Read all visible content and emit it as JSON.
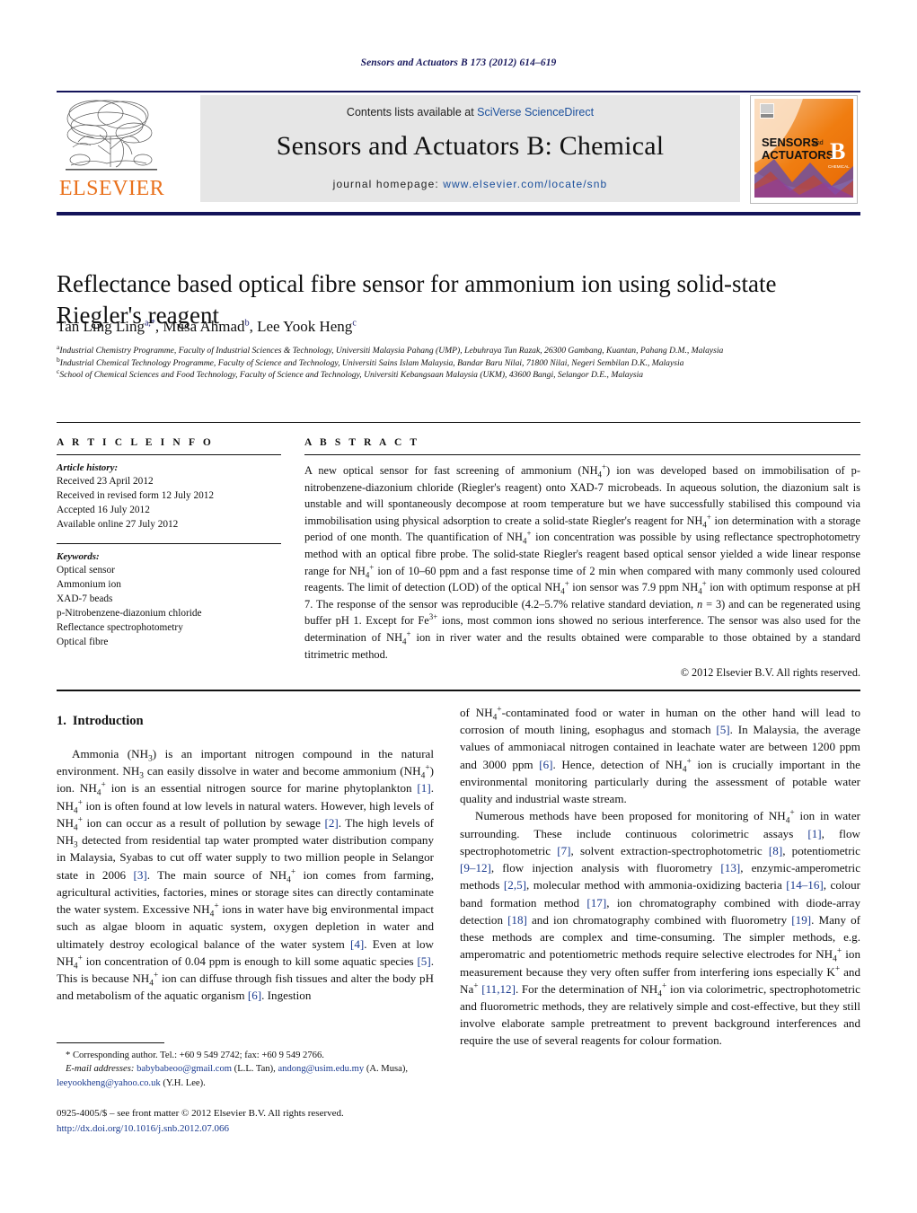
{
  "running_head": "Sensors and Actuators B 173 (2012) 614–619",
  "masthead": {
    "publisher_name": "ELSEVIER",
    "contents_prefix": "Contents lists available at ",
    "contents_link": "SciVerse ScienceDirect",
    "journal_name": "Sensors and Actuators B: Chemical",
    "homepage_prefix": "journal homepage:",
    "homepage_url": "www.elsevier.com/locate/snb",
    "cover_line1": "SENSORS",
    "cover_and": "and",
    "cover_line2": "ACTUATORS",
    "cover_letter": "B",
    "cover_sub": "CHEMICAL"
  },
  "article": {
    "title": "Reflectance based optical fibre sensor for ammonium ion using solid-state Riegler's reagent",
    "authors_plain": "Tan Ling Ling a,*, Musa Ahmad b, Lee Yook Heng c",
    "affiliations": [
      {
        "marker": "a",
        "text": "Industrial Chemistry Programme, Faculty of Industrial Sciences & Technology, Universiti Malaysia Pahang (UMP), Lebuhraya Tun Razak, 26300 Gambang, Kuantan, Pahang D.M., Malaysia"
      },
      {
        "marker": "b",
        "text": "Industrial Chemical Technology Programme, Faculty of Science and Technology, Universiti Sains Islam Malaysia, Bandar Baru Nilai, 71800 Nilai, Negeri Sembilan D.K., Malaysia"
      },
      {
        "marker": "c",
        "text": "School of Chemical Sciences and Food Technology, Faculty of Science and Technology, Universiti Kebangsaan Malaysia (UKM), 43600 Bangi, Selangor D.E., Malaysia"
      }
    ]
  },
  "article_info": {
    "heading": "A R T I C L E   I N F O",
    "history_label": "Article history:",
    "history": [
      "Received 23 April 2012",
      "Received in revised form 12 July 2012",
      "Accepted 16 July 2012",
      "Available online 27 July 2012"
    ],
    "keywords_label": "Keywords:",
    "keywords": [
      "Optical sensor",
      "Ammonium ion",
      "XAD-7 beads",
      "p-Nitrobenzene-diazonium chloride",
      "Reflectance spectrophotometry",
      "Optical fibre"
    ]
  },
  "abstract": {
    "heading": "A B S T R A C T",
    "copyright": "© 2012 Elsevier B.V. All rights reserved."
  },
  "introduction": {
    "number": "1.",
    "heading": "Introduction"
  },
  "footnote": {
    "corresponding": "* Corresponding author. Tel.: +60 9 549 2742; fax: +60 9 549 2766.",
    "email_label": "E-mail addresses:",
    "email1": "babybabeoo@gmail.com",
    "email1_owner": "(L.L. Tan),",
    "email2": "andong@usim.edu.my",
    "email2_owner": "(A. Musa),",
    "email3": "leeyookheng@yahoo.co.uk",
    "email3_owner": "(Y.H. Lee).",
    "imprint": "0925-4005/$ – see front matter © 2012 Elsevier B.V. All rights reserved.",
    "doi": "http://dx.doi.org/10.1016/j.snb.2012.07.066"
  },
  "colors": {
    "navy": "#14145a",
    "link_blue": "#1a4f9c",
    "citation_blue": "#1a3a8f",
    "elsevier_orange": "#E9711C",
    "masthead_grey": "#e6e6e6"
  }
}
